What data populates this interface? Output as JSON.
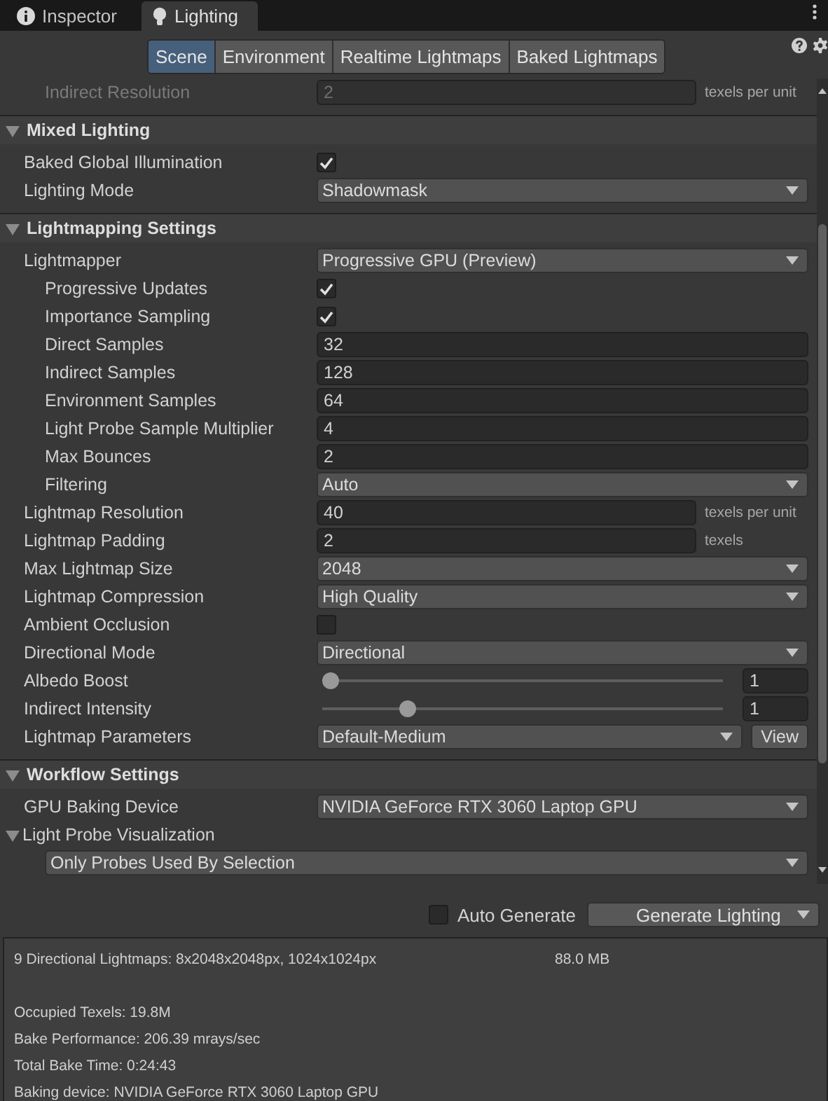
{
  "window_tabs": [
    {
      "label": "Inspector",
      "selected": false
    },
    {
      "label": "Lighting",
      "selected": true
    }
  ],
  "toolbar_tabs": [
    {
      "label": "Scene",
      "selected": true
    },
    {
      "label": "Environment",
      "selected": false
    },
    {
      "label": "Realtime Lightmaps",
      "selected": false
    },
    {
      "label": "Baked Lightmaps",
      "selected": false
    }
  ],
  "top_rows": [
    {
      "label": "Indirect Resolution",
      "kind": "number",
      "value": "2",
      "unit": "texels per unit",
      "disabled": true,
      "children": []
    }
  ],
  "sections": [
    {
      "title": "Mixed Lighting",
      "expanded": true,
      "rows": [
        {
          "label": "Baked Global Illumination",
          "kind": "checkbox",
          "checked": true,
          "disabled": false
        },
        {
          "label": "Lighting Mode",
          "kind": "dropdown",
          "value": "Shadowmask",
          "disabled": false
        }
      ]
    },
    {
      "title": "Lightmapping Settings",
      "expanded": true,
      "rows": [
        {
          "label": "Lightmapper",
          "kind": "dropdown",
          "value": "Progressive GPU (Preview)",
          "disabled": false,
          "children": [
            {
              "label": "Progressive Updates",
              "kind": "checkbox",
              "checked": true,
              "disabled": false
            },
            {
              "label": "Importance Sampling",
              "kind": "checkbox",
              "checked": true,
              "disabled": false
            },
            {
              "label": "Direct Samples",
              "kind": "number",
              "value": "32",
              "disabled": false
            },
            {
              "label": "Indirect Samples",
              "kind": "number",
              "value": "128",
              "disabled": false
            },
            {
              "label": "Environment Samples",
              "kind": "number",
              "value": "64",
              "disabled": false
            },
            {
              "label": "Light Probe Sample Multiplier",
              "kind": "number",
              "value": "4",
              "disabled": false
            },
            {
              "label": "Max Bounces",
              "kind": "number",
              "value": "2",
              "disabled": false
            },
            {
              "label": "Filtering",
              "kind": "dropdown",
              "value": "Auto",
              "disabled": false
            }
          ]
        },
        {
          "label": "Lightmap Resolution",
          "kind": "number",
          "value": "40",
          "unit": "texels per unit",
          "disabled": false
        },
        {
          "label": "Lightmap Padding",
          "kind": "number",
          "value": "2",
          "unit": "texels",
          "disabled": false
        },
        {
          "label": "Max Lightmap Size",
          "kind": "dropdown",
          "value": "2048",
          "disabled": false
        },
        {
          "label": "Lightmap Compression",
          "kind": "dropdown",
          "value": "High Quality",
          "disabled": false
        },
        {
          "label": "Ambient Occlusion",
          "kind": "checkbox",
          "checked": false,
          "disabled": false
        },
        {
          "label": "Directional Mode",
          "kind": "dropdown",
          "value": "Directional",
          "disabled": false
        },
        {
          "label": "Albedo Boost",
          "kind": "slider",
          "level": 0,
          "value": "1",
          "disabled": false
        },
        {
          "label": "Indirect Intensity",
          "kind": "slider",
          "level": 0.2,
          "value": "1",
          "disabled": false
        },
        {
          "label": "Lightmap Parameters",
          "kind": "dropdown",
          "value": "Default-Medium",
          "button": "View",
          "disabled": false
        }
      ]
    },
    {
      "title": "Workflow Settings",
      "expanded": true,
      "rows": [
        {
          "label": "GPU Baking Device",
          "kind": "dropdown",
          "value": "NVIDIA GeForce RTX 3060 Laptop GPU",
          "disabled": false
        }
      ]
    }
  ],
  "foldout": {
    "label": "Light Probe Visualization",
    "expanded": true,
    "children": [
      {
        "kind": "dropdown",
        "value": "Only Probes Used By Selection",
        "disabled": false
      }
    ]
  },
  "auto_generate": {
    "label": "Auto Generate",
    "checked": false
  },
  "generate_button": {
    "label": "Generate Lighting"
  },
  "stats": {
    "summary": "9 Directional Lightmaps: 8x2048x2048px, 1024x1024px",
    "size": "88.0 MB",
    "lines": [
      "Occupied Texels: 19.8M",
      "Bake Performance: 206.39 mrays/sec",
      "Total Bake Time: 0:24:43",
      "Baking device: NVIDIA GeForce RTX 3060 Laptop GPU"
    ]
  }
}
